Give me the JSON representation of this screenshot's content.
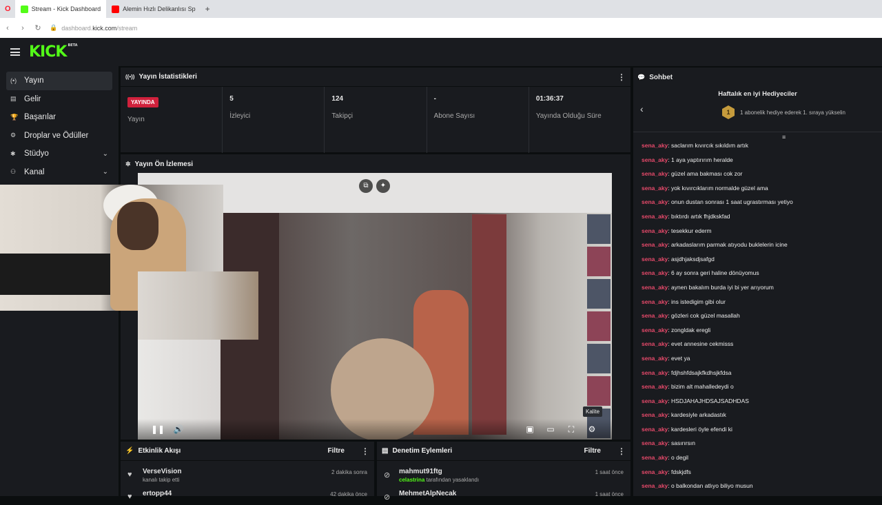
{
  "browser": {
    "tabs": [
      {
        "title": "Stream - Kick Dashboard",
        "favicon_color": "#53fc18"
      },
      {
        "title": "Alemin Hızlı Delikanlısı Sp",
        "favicon_color": "#ff0000"
      }
    ],
    "new_tab_symbol": "+",
    "url_domain": "kick.com",
    "url_prefix": "dashboard.",
    "url_path": "/stream"
  },
  "header": {
    "logo": "KICK",
    "logo_badge": "BETA"
  },
  "sidebar": {
    "items": [
      {
        "label": "Yayın",
        "icon": "broadcast-icon",
        "glyph": "(•)",
        "active": true
      },
      {
        "label": "Gelir",
        "icon": "revenue-icon",
        "glyph": "▤"
      },
      {
        "label": "Başarılar",
        "icon": "trophy-icon",
        "glyph": "🏆"
      },
      {
        "label": "Droplar ve Ödüller",
        "icon": "gift-icon",
        "glyph": "⚙"
      },
      {
        "label": "Stüdyo",
        "icon": "studio-icon",
        "glyph": "✱",
        "expandable": true
      },
      {
        "label": "Kanal",
        "icon": "channel-icon",
        "glyph": "⚇",
        "expandable": true
      }
    ]
  },
  "stats_panel": {
    "title": "Yayın İstatistikleri",
    "live_badge": "YAYINDA",
    "stats": [
      {
        "value": "",
        "label": "Yayın"
      },
      {
        "value": "5",
        "label": "İzleyici"
      },
      {
        "value": "124",
        "label": "Takipçi"
      },
      {
        "value": "-",
        "label": "Abone Sayısı"
      },
      {
        "value": "01:36:37",
        "label": "Yayında Olduğu Süre"
      }
    ]
  },
  "preview_panel": {
    "title": "Yayın Ön İzlemesi",
    "tooltip": "Kalite"
  },
  "chat": {
    "title": "Sohbet",
    "gifters_title": "Haftalık en iyi Hediyeciler",
    "rank_number": "1",
    "rank_text": "1 abonelik hediye ederek 1. sıraya yükselin",
    "messages": [
      {
        "user": "sena_aky",
        "text": ": saclarım kıvırcık sıkıldım artık"
      },
      {
        "user": "sena_aky",
        "text": ": 1 aya yaptırırım heralde"
      },
      {
        "user": "sena_aky",
        "text": ": güzel ama bakması cok zor"
      },
      {
        "user": "sena_aky",
        "text": ": yok kıvırcıklarım normalde güzel ama"
      },
      {
        "user": "sena_aky",
        "text": ": onun dustan sonrası 1 saat ugrastırması yetiyo"
      },
      {
        "user": "sena_aky",
        "text": ": bıktırdı artık fhjdkskfad"
      },
      {
        "user": "sena_aky",
        "text": ": tesekkur ederm"
      },
      {
        "user": "sena_aky",
        "text": ": arkadaslarım parmak atıyodu buklelerin icine"
      },
      {
        "user": "sena_aky",
        "text": ": asjdhjaksdjsafgd"
      },
      {
        "user": "sena_aky",
        "text": ": 6 ay sonra geri haline dönüyomus"
      },
      {
        "user": "sena_aky",
        "text": ": aynen bakalım burda iyi bi yer arıyorum"
      },
      {
        "user": "sena_aky",
        "text": ": ins istedigim gibi olur"
      },
      {
        "user": "sena_aky",
        "text": ": gözleri cok güzel masallah"
      },
      {
        "user": "sena_aky",
        "text": ": zongldak eregli"
      },
      {
        "user": "sena_aky",
        "text": ": evet annesine cekmisss"
      },
      {
        "user": "sena_aky",
        "text": ": evet ya"
      },
      {
        "user": "sena_aky",
        "text": ": fdjhshfdsajkfkdhsjkfdsa"
      },
      {
        "user": "sena_aky",
        "text": ": bizim alt mahalledeydi o"
      },
      {
        "user": "sena_aky",
        "text": ": HSDJAHAJHDSAJSADHDAS"
      },
      {
        "user": "sena_aky",
        "text": ": kardesiyle arkadastık"
      },
      {
        "user": "sena_aky",
        "text": ": kardesleri öyle efendi ki"
      },
      {
        "user": "sena_aky",
        "text": ": sasırırsın"
      },
      {
        "user": "sena_aky",
        "text": ": o degil"
      },
      {
        "user": "sena_aky",
        "text": ": fdskjdfs"
      },
      {
        "user": "sena_aky",
        "text": ": o balkondan atlıyo biliyo musun"
      }
    ]
  },
  "activity_panel": {
    "title": "Etkinlik Akışı",
    "filter": "Filtre",
    "events": [
      {
        "name": "VerseVision",
        "sub": "kanalı takip etti",
        "time": "2 dakika sonra"
      },
      {
        "name": "ertopp44",
        "sub": "",
        "time": "42 dakika önce"
      }
    ]
  },
  "moderation_panel": {
    "title": "Denetim Eylemleri",
    "filter": "Filtre",
    "events": [
      {
        "name": "mahmut91ftg",
        "moderator": "celastrina",
        "sub": " tarafından yasaklandı",
        "time": "1 saat önce"
      },
      {
        "name": "MehmetAlpNecak",
        "moderator": "",
        "sub": "",
        "time": "1 saat önce"
      }
    ]
  },
  "colors": {
    "brand": "#53fc18",
    "live": "#d0213c",
    "chat_user": "#e84a6b",
    "panel_bg": "#191b1f",
    "page_bg": "#0b0e0f"
  }
}
